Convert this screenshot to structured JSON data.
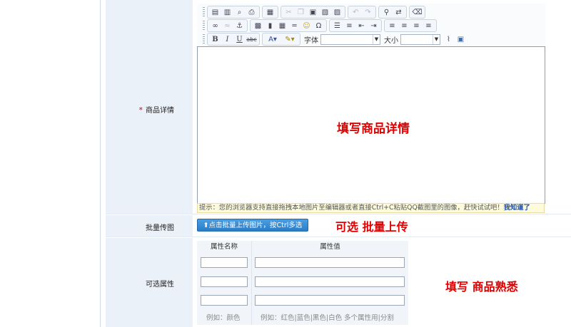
{
  "form": {
    "detail_label": "商品详情",
    "required_mark": "*",
    "batch_label": "批量传图",
    "attr_label": "可选属性"
  },
  "editor": {
    "font_label": "字体",
    "size_label": "大小",
    "font_value": "",
    "size_value": "",
    "tip_text": "提示：您的浏览器支持直接拖拽本地图片至编辑器或者直接Ctrl+C粘贴QQ截图里的图像，赶快试试吧！",
    "tip_link": "我知道了"
  },
  "upload": {
    "button_label": "点击批量上传图片，按Ctrl多选",
    "arrow_glyph": "⬆"
  },
  "attributes": {
    "col_name": "属性名称",
    "col_value": "属性值",
    "rows": [
      {
        "name": "",
        "value": ""
      },
      {
        "name": "",
        "value": ""
      },
      {
        "name": "",
        "value": ""
      }
    ],
    "example_name": "例如：颜色",
    "example_value": "例如：红色|蓝色|黑色|白色 多个属性用|分割"
  },
  "annotations": {
    "detail": "填写商品详情",
    "batch": "可选  批量上传",
    "attr": "填写  商品熟悉"
  },
  "icons": {
    "row1": [
      "source-icon",
      "paste-plain-icon",
      "preview-icon",
      "print-icon",
      "template-icon",
      "cut-icon",
      "copy-icon",
      "paste-icon",
      "paste-text-icon",
      "paste-word-icon",
      "undo-icon",
      "redo-icon",
      "find-icon",
      "replace-icon",
      "eraser-icon"
    ],
    "row2": [
      "link-icon",
      "unlink-icon",
      "anchor-icon",
      "image-icon",
      "flash-icon",
      "table-icon",
      "hr-icon",
      "smiley-icon",
      "special-char-icon",
      "ordered-list-icon",
      "unordered-list-icon",
      "outdent-icon",
      "indent-icon",
      "align-left-icon",
      "align-center-icon",
      "align-right-icon",
      "align-justify-icon"
    ],
    "row3": [
      "bold-icon",
      "italic-icon",
      "underline-icon",
      "strike-icon",
      "font-color-icon",
      "bg-color-icon",
      "attach-icon",
      "fullscreen-icon"
    ]
  },
  "colors": {
    "label_bg": "#eaf1f8",
    "accent_red": "#e00000",
    "button_blue": "#2a7cc8",
    "tip_bg": "#fefbdc"
  }
}
